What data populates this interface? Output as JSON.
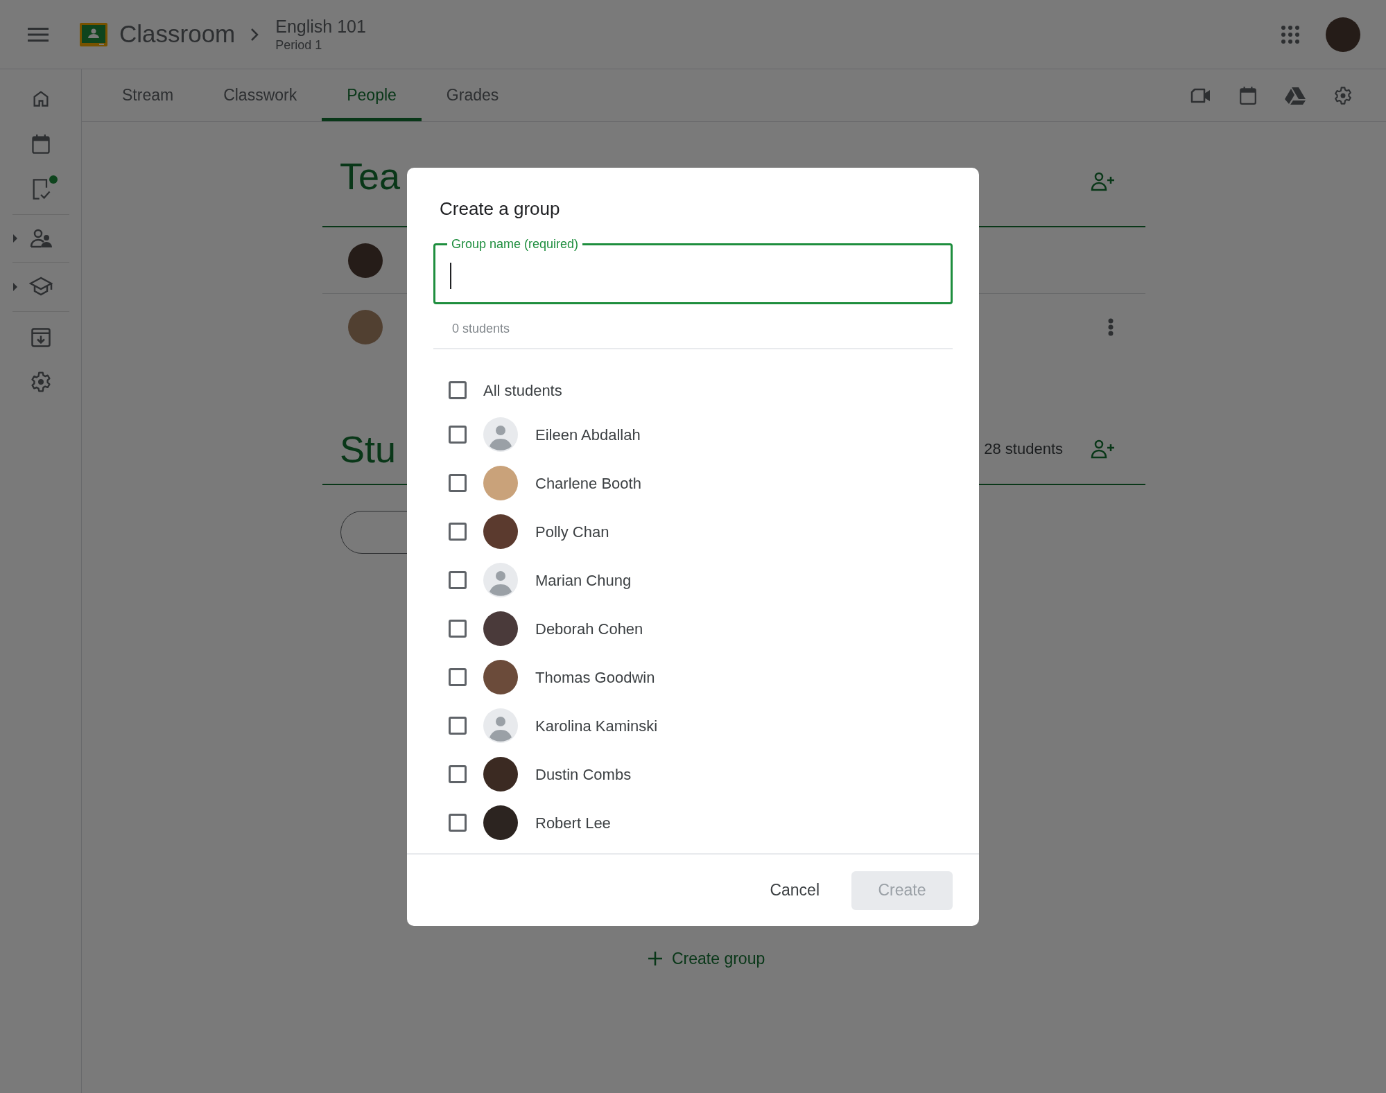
{
  "app_bar": {
    "product": "Classroom",
    "class_name": "English 101",
    "section": "Period 1"
  },
  "tabs": [
    {
      "label": "Stream",
      "selected": false
    },
    {
      "label": "Classwork",
      "selected": false
    },
    {
      "label": "People",
      "selected": true
    },
    {
      "label": "Grades",
      "selected": false
    }
  ],
  "teachers": {
    "heading": "Tea"
  },
  "students_section": {
    "heading": "Stu",
    "count": "28 students"
  },
  "create_group_link": "Create group",
  "dialog": {
    "title": "Create a group",
    "field": {
      "label": "Group name (required)",
      "focused": true
    },
    "selected_count": "0 students",
    "all_option": {
      "label": "All students",
      "checked": false
    },
    "students": [
      {
        "name": "Eileen Abdallah",
        "kind": "default",
        "checked": false
      },
      {
        "name": "Charlene Booth",
        "kind": "photo",
        "checked": false
      },
      {
        "name": "Polly Chan",
        "kind": "photo",
        "checked": false
      },
      {
        "name": "Marian Chung",
        "kind": "default",
        "checked": false
      },
      {
        "name": "Deborah Cohen",
        "kind": "photo",
        "checked": false
      },
      {
        "name": "Thomas Goodwin",
        "kind": "photo",
        "checked": false
      },
      {
        "name": "Karolina Kaminski",
        "kind": "default",
        "checked": false
      },
      {
        "name": "Dustin Combs",
        "kind": "photo",
        "checked": false
      },
      {
        "name": "Robert Lee",
        "kind": "photo",
        "checked": false
      }
    ],
    "cancel_button": "Cancel",
    "create_button": {
      "label": "Create",
      "disabled": true
    }
  }
}
